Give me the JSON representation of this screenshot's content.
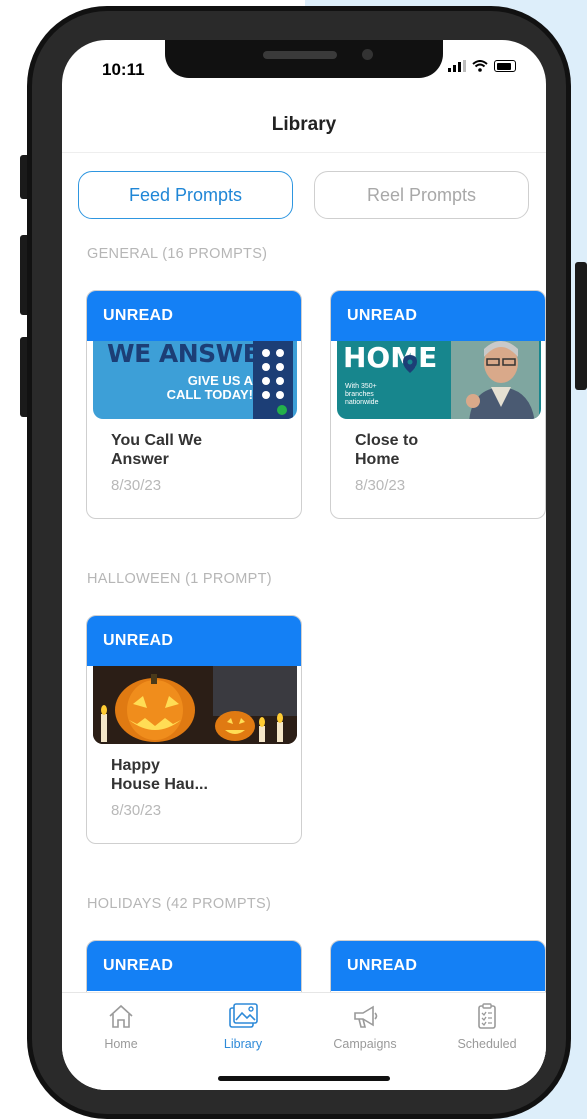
{
  "status_bar": {
    "time": "10:11"
  },
  "header": {
    "title": "Library"
  },
  "segments": [
    {
      "label": "Feed Prompts",
      "active": true
    },
    {
      "label": "Reel Prompts",
      "active": false
    }
  ],
  "sections": [
    {
      "heading": "GENERAL (16 PROMPTS)"
    },
    {
      "heading": "HALLOWEEN (1 PROMPT)"
    },
    {
      "heading": "HOLIDAYS (42 PROMPTS)"
    }
  ],
  "cards": [
    {
      "badge": "UNREAD",
      "title_line1": "You Call We",
      "title_line2": "Answer",
      "date": "8/30/23",
      "image_text_big": "WE ANSWER",
      "image_text_small1": "GIVE US A",
      "image_text_small2": "CALL TODAY!"
    },
    {
      "badge": "UNREAD",
      "title_line1": "Close to",
      "title_line2": "Home",
      "date": "8/30/23",
      "image_text_big": "HOME",
      "image_text_small1": "With 350+",
      "image_text_small2": "branches",
      "image_text_small3": "nationwide"
    },
    {
      "badge": "UNREAD",
      "title_line1": "Happy",
      "title_line2": "House Hau...",
      "date": "8/30/23"
    },
    {
      "badge": "UNREAD"
    },
    {
      "badge": "UNREAD"
    }
  ],
  "tabbar": [
    {
      "label": "Home",
      "icon": "house-icon",
      "active": false
    },
    {
      "label": "Library",
      "icon": "images-icon",
      "active": true
    },
    {
      "label": "Campaigns",
      "icon": "megaphone-icon",
      "active": false
    },
    {
      "label": "Scheduled",
      "icon": "clipboard-icon",
      "active": false
    }
  ],
  "colors": {
    "accent": "#1480f5",
    "tab_active": "#2e8ad8",
    "background_accent": "#ddeefa"
  }
}
